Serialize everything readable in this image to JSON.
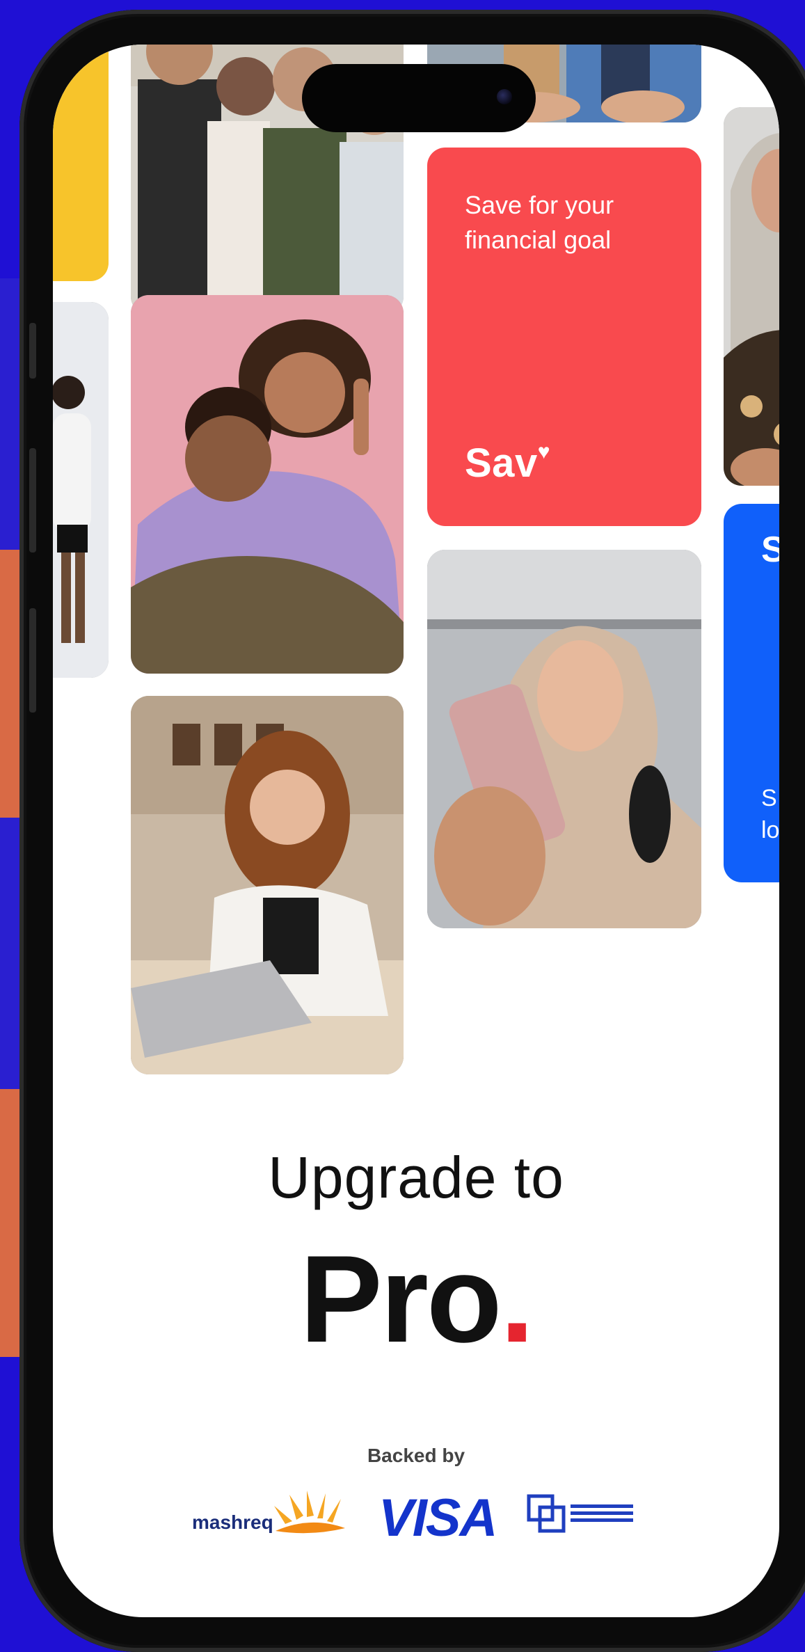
{
  "promo_cards": {
    "savings": {
      "tagline": "Save for your financial goal",
      "brand": "Sav",
      "brand_mark": "♥"
    },
    "partial_blue": {
      "title_fragment": "S",
      "text_fragment_1": "S",
      "text_fragment_2": "lo"
    }
  },
  "headline": {
    "line1": "Upgrade to",
    "line2": "Pro",
    "accent": "."
  },
  "backers": {
    "label": "Backed by",
    "logos": [
      "mashreq",
      "VISA"
    ]
  },
  "colors": {
    "background": "#1f10d4",
    "savings_card": "#f94a4e",
    "blue_card": "#1060fa",
    "yellow_card": "#f7c42b",
    "pro_dot": "#e5252f"
  }
}
